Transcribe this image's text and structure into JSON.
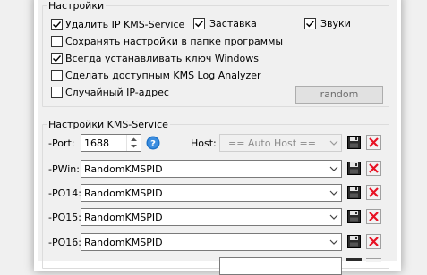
{
  "settings": {
    "legend": "Настройки",
    "options": [
      {
        "label": "Удалить IP KMS-Service",
        "checked": true
      },
      {
        "label": "Заставка",
        "checked": true
      },
      {
        "label": "Звуки",
        "checked": true
      },
      {
        "label": "Сохранять настройки  в папке программы",
        "checked": false
      },
      {
        "label": "Всегда устанавливать ключ Windows",
        "checked": true
      },
      {
        "label": "Сделать доступным KMS Log Analyzer",
        "checked": false
      },
      {
        "label": "Случайный IP-адрес",
        "checked": false
      }
    ],
    "random_button": "random"
  },
  "kms": {
    "legend": "Настройки KMS-Service",
    "port_label": "-Port:",
    "port_value": "1688",
    "help_icon": "help-icon",
    "host_label": "Host:",
    "host_value": "== Auto Host ==",
    "rows": [
      {
        "label": "-PWin:",
        "value": "RandomKMSPID"
      },
      {
        "label": "-PO14:",
        "value": "RandomKMSPID"
      },
      {
        "label": "-PO15:",
        "value": "RandomKMSPID"
      },
      {
        "label": "-PO16:",
        "value": "RandomKMSPID"
      }
    ]
  },
  "icons": {
    "save": "floppy-save-icon",
    "delete": "red-x-delete-icon"
  },
  "colors": {
    "accent": "#0078d7",
    "delete": "#e81123",
    "help": "#1e73c8"
  }
}
